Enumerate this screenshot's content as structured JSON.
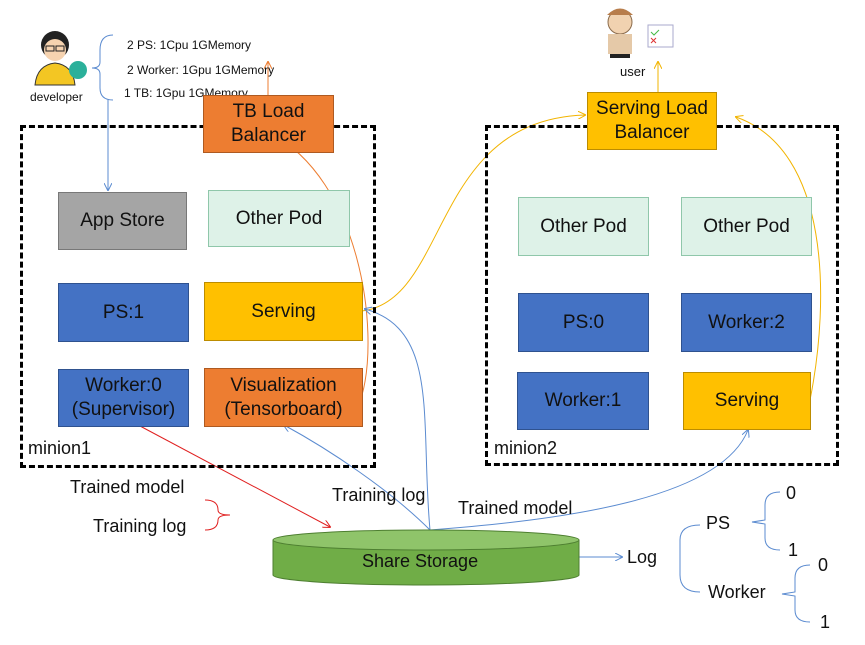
{
  "developer": {
    "label": "developer",
    "specs": [
      "2 PS: 1Cpu 1GMemory",
      "2 Worker: 1Gpu 1GMemory",
      "1 TB: 1Gpu 1GMemory"
    ]
  },
  "user": {
    "label": "user"
  },
  "tb_lb": "TB Load Balancer",
  "serving_lb": "Serving Load Balancer",
  "minion1": {
    "label": "minion1",
    "app_store": "App Store",
    "other_pod": "Other Pod",
    "ps": "PS:1",
    "serving": "Serving",
    "worker": "Worker:0\n(Supervisor)",
    "worker_l1": "Worker:0",
    "worker_l2": "(Supervisor)",
    "vis_l1": "Visualization",
    "vis_l2": "(Tensorboard)"
  },
  "minion2": {
    "label": "minion2",
    "other_pod_1": "Other Pod",
    "other_pod_2": "Other Pod",
    "ps": "PS:0",
    "worker2": "Worker:2",
    "worker1": "Worker:1",
    "serving": "Serving"
  },
  "storage": "Share Storage",
  "labels": {
    "trained_model_left": "Trained model",
    "training_log_left": "Training log",
    "training_log_mid": "Training log",
    "trained_model_mid": "Trained model"
  },
  "log_tree": {
    "log": "Log",
    "ps": "PS",
    "worker": "Worker",
    "ps_0": "0",
    "ps_1": "1",
    "worker_0": "0",
    "worker_1": "1"
  },
  "colors": {
    "blue": "#4472C4",
    "yellow": "#FFC000",
    "orange": "#ED7D31",
    "gray": "#A5A5A5",
    "green": "#70AD47",
    "light": "#DEF2E8"
  }
}
